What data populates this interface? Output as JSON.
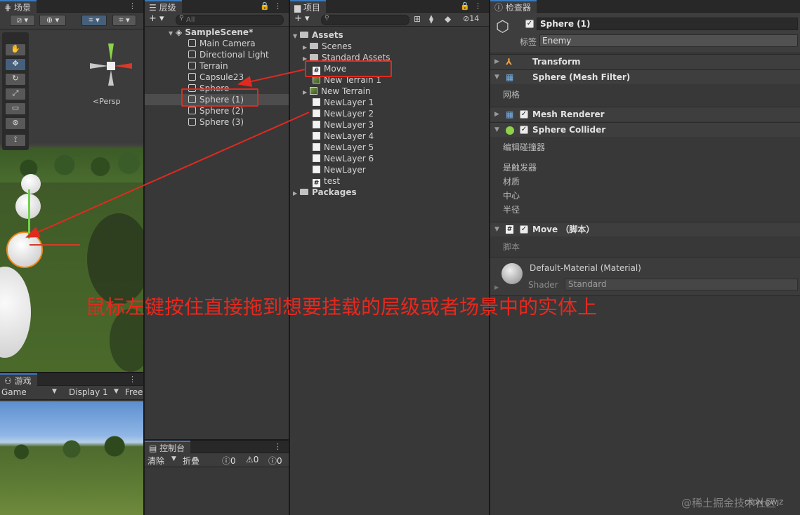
{
  "scene": {
    "tab": "场景",
    "persp": "<Persp"
  },
  "game": {
    "tab": "游戏",
    "mode": "Game",
    "display": "Display 1",
    "aspect": "Free"
  },
  "hierarchy": {
    "tab": "层级",
    "add": "+ ▾",
    "search_placeholder": "All",
    "scene_name": "SampleScene*",
    "items": [
      "Main Camera",
      "Directional Light",
      "Terrain",
      "Capsule23",
      "Sphere",
      "Sphere (1)",
      "Sphere (2)",
      "Sphere (3)"
    ]
  },
  "project": {
    "tab": "项目",
    "add": "+ ▾",
    "hidden_count": "14",
    "root": "Assets",
    "folders": [
      "Scenes",
      "Standard Assets"
    ],
    "assets": [
      {
        "name": "Move",
        "icon": "script"
      },
      {
        "name": "New Terrain 1",
        "icon": "terrain"
      },
      {
        "name": "New Terrain",
        "icon": "terrain"
      },
      {
        "name": "NewLayer 1",
        "icon": "layer"
      },
      {
        "name": "NewLayer 2",
        "icon": "layer"
      },
      {
        "name": "NewLayer 3",
        "icon": "layer"
      },
      {
        "name": "NewLayer 4",
        "icon": "layer"
      },
      {
        "name": "NewLayer 5",
        "icon": "layer"
      },
      {
        "name": "NewLayer 6",
        "icon": "layer"
      },
      {
        "name": "NewLayer",
        "icon": "layer"
      },
      {
        "name": "test",
        "icon": "script"
      }
    ],
    "packages": "Packages"
  },
  "console": {
    "tab": "控制台",
    "clear": "清除",
    "collapse": "折叠",
    "count_info": "0",
    "count_warn": "0",
    "count_error": "0"
  },
  "inspector": {
    "tab": "检查器",
    "object_name": "Sphere (1)",
    "tag_label": "标签",
    "tag_value": "Enemy",
    "transform": "Transform",
    "mesh_filter": "Sphere (Mesh Filter)",
    "mesh_label": "网格",
    "mesh_renderer": "Mesh Renderer",
    "collider": "Sphere Collider",
    "edit_collider": "编辑碰撞器",
    "is_trigger": "是触发器",
    "material": "材质",
    "center": "中心",
    "radius": "半径",
    "script_comp": "Move （脚本）",
    "script_label": "脚本",
    "material_name": "Default-Material (Material)",
    "shader_label": "Shader",
    "shader_value": "Standard"
  },
  "annotation": "鼠标左键按住直接拖到想要挂载的层级或者场景中的实体上",
  "watermark": "@稀土掘金技术社区",
  "watermark2": "CSDN @WJZ"
}
